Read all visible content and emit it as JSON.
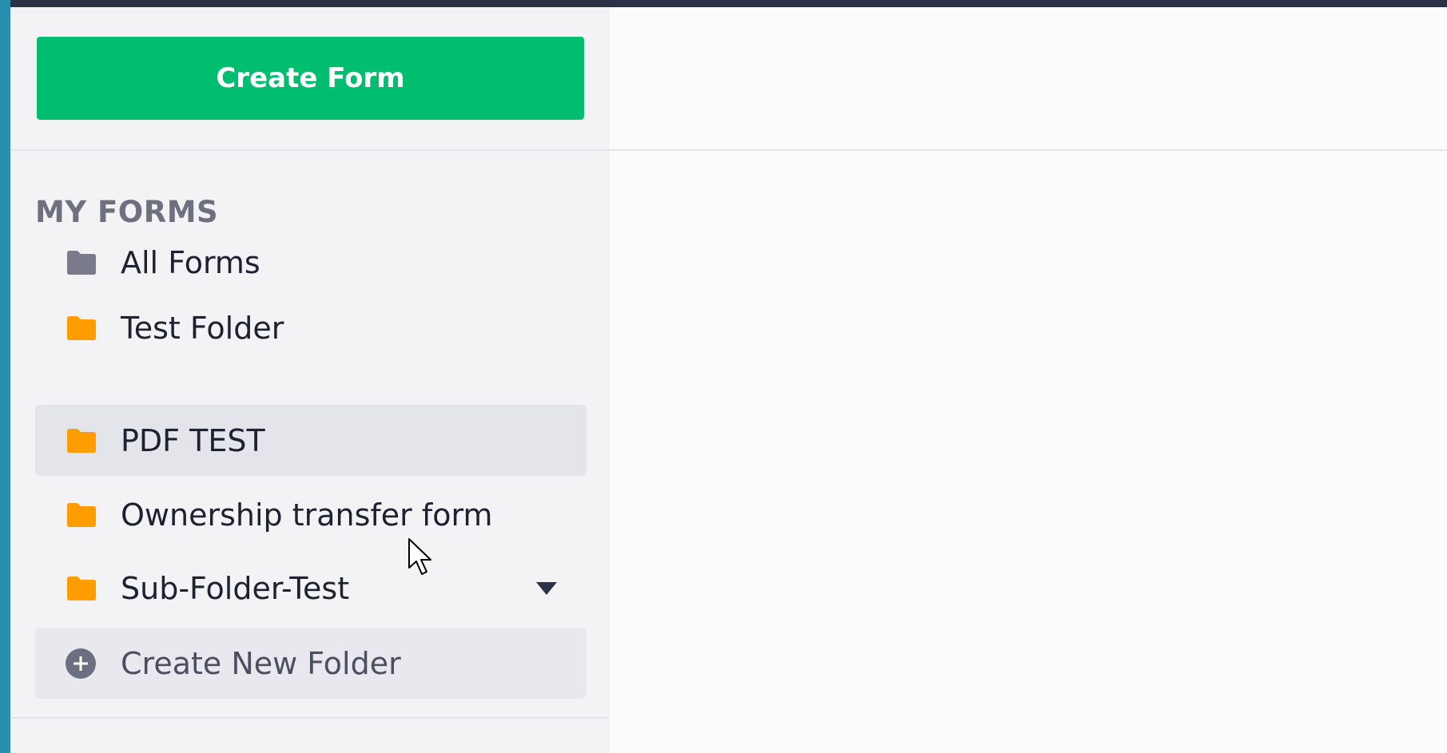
{
  "header": {
    "create_form_label": "Create Form"
  },
  "sidebar": {
    "section_title": "MY FORMS",
    "items": [
      {
        "label": "All Forms",
        "icon": "folder-icon",
        "color": "#7a7a8c"
      },
      {
        "label": "Test Folder",
        "icon": "folder-icon",
        "color": "#ff9d00"
      },
      {
        "label": "PDF TEST",
        "icon": "folder-icon",
        "color": "#ff9d00",
        "selected": true
      },
      {
        "label": "Ownership transfer form",
        "icon": "folder-icon",
        "color": "#ff9d00"
      },
      {
        "label": "Sub-Folder-Test",
        "icon": "folder-icon",
        "color": "#ff9d00",
        "expandable": true
      }
    ],
    "create_folder_label": "Create New Folder"
  },
  "colors": {
    "primary_green": "#01bd6f",
    "folder_orange": "#ff9d00",
    "folder_gray": "#7a7a8c",
    "top_bar": "#2b3245"
  }
}
